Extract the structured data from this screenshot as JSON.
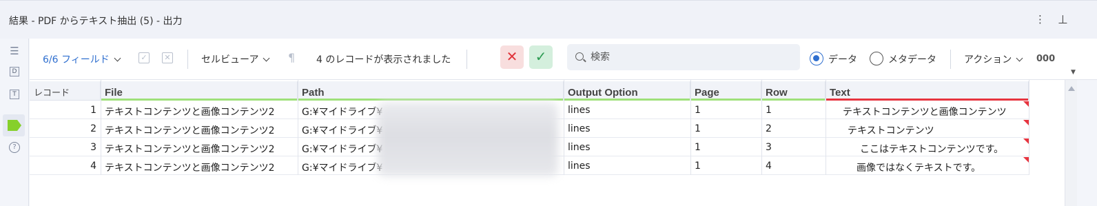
{
  "window": {
    "title": "結果 - PDF からテキスト抽出 (5) - 出力"
  },
  "toolbar": {
    "fields_label": "6/6 フィールド",
    "cell_viewer_label": "セルビューア",
    "record_status": "4 のレコードが表示されました",
    "search_placeholder": "検索",
    "data_radio_label": "データ",
    "metadata_radio_label": "メタデータ",
    "action_label": "アクション",
    "more_label": "000"
  },
  "table": {
    "headers": {
      "record": "レコード",
      "file": "File",
      "path": "Path",
      "output_option": "Output Option",
      "page": "Page",
      "row": "Row",
      "text": "Text"
    },
    "rows": [
      {
        "record": "1",
        "file": "テキストコンテンツと画像コンテンツ2",
        "path": "G:¥マイドライブ¥",
        "output_option": "lines",
        "page": "1",
        "row": "1",
        "text": "テキストコンテンツと画像コンテンツ"
      },
      {
        "record": "2",
        "file": "テキストコンテンツと画像コンテンツ2",
        "path": "G:¥マイドライブ¥",
        "output_option": "lines",
        "page": "1",
        "row": "2",
        "text": "テキストコンテンツ"
      },
      {
        "record": "3",
        "file": "テキストコンテンツと画像コンテンツ2",
        "path": "G:¥マイドライブ¥",
        "output_option": "lines",
        "page": "1",
        "row": "3",
        "text": "ここはテキストコンテンツです。"
      },
      {
        "record": "4",
        "file": "テキストコンテンツと画像コンテンツ2",
        "path": "G:¥マイドライブ¥",
        "output_option": "lines",
        "page": "1",
        "row": "4",
        "text": "画像ではなくテキストです。"
      }
    ]
  },
  "colors": {
    "accent_blue": "#2f6fcf",
    "header_underline_green": "#9fe07a",
    "header_underline_red": "#e7343f",
    "cancel_red": "#e0333a",
    "confirm_green": "#2c9b52"
  }
}
